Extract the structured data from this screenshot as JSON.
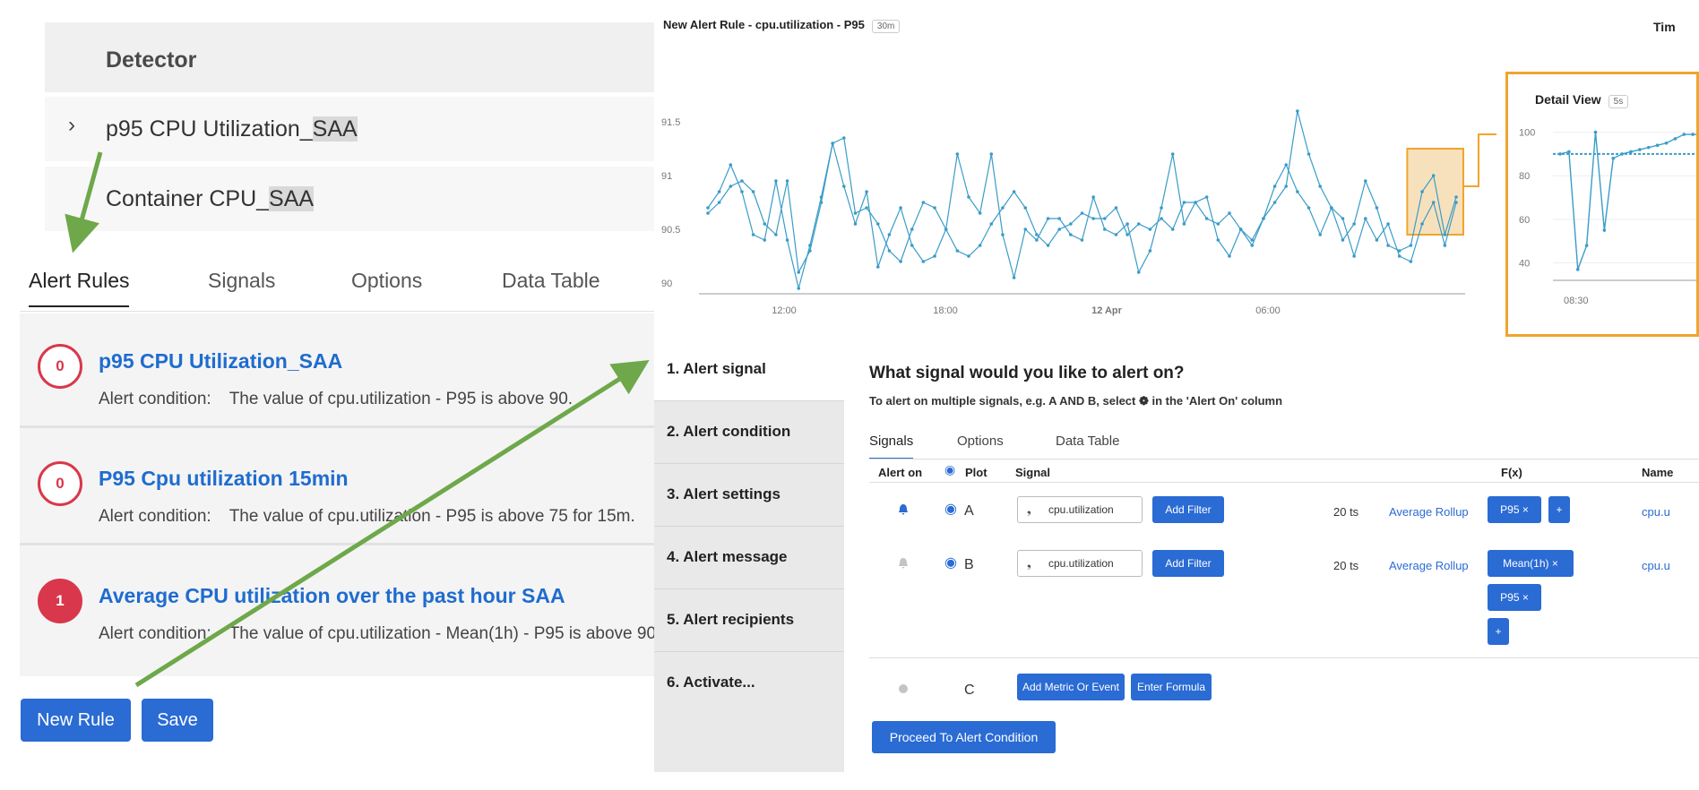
{
  "detector": {
    "header": "Detector",
    "items": [
      {
        "prefix": "p95 CPU Utilization_",
        "highlight": "SAA"
      },
      {
        "prefix": "Container CPU_",
        "highlight": "SAA"
      }
    ]
  },
  "tabs": [
    "Alert Rules",
    "Signals",
    "Options",
    "Data Table"
  ],
  "rules": [
    {
      "count": "0",
      "title": "p95 CPU Utilization_SAA",
      "cond_label": "Alert condition:",
      "cond_text": "The value of cpu.utilization - P95 is above 90."
    },
    {
      "count": "0",
      "title": "P95 Cpu utilization 15min",
      "cond_label": "Alert condition:",
      "cond_text": "The value of cpu.utilization - P95 is above 75 for 15m."
    },
    {
      "count": "1",
      "title": "Average CPU utilization over the past hour SAA",
      "cond_label": "Alert condition:",
      "cond_text": "The value of cpu.utilization - Mean(1h) - P95 is above 90."
    }
  ],
  "buttons": {
    "new_rule": "New Rule",
    "save": "Save"
  },
  "chart": {
    "title": "New Alert Rule - cpu.utilization - P95",
    "range": "30m",
    "time_label": "Tim",
    "detail_title": "Detail View",
    "detail_range": "5s",
    "colors": {
      "line": "#3a9cc8",
      "highlight": "#f0a52c"
    }
  },
  "chart_data": [
    {
      "type": "line",
      "title": "",
      "y_ticks": [
        "90",
        "90.5",
        "91",
        "91.5"
      ],
      "x_ticks": [
        "12:00",
        "18:00",
        "12 Apr",
        "06:00"
      ],
      "ylim": [
        89.9,
        91.8
      ],
      "series": [
        {
          "values": [
            90.7,
            90.85,
            91.1,
            90.85,
            90.45,
            90.4,
            90.95,
            90.4,
            89.95,
            90.35,
            90.8,
            91.3,
            91.35,
            90.65,
            90.7,
            90.55,
            90.3,
            90.2,
            90.5,
            90.75,
            90.7,
            90.5,
            90.3,
            90.25,
            90.35,
            90.55,
            90.7,
            90.85,
            90.7,
            90.45,
            90.35,
            90.5,
            90.55,
            90.65,
            90.6,
            90.6,
            90.7,
            90.45,
            90.55,
            90.5,
            90.6,
            90.5,
            90.75,
            90.75,
            90.6,
            90.55,
            90.65,
            90.5,
            90.4,
            90.6,
            90.75,
            90.9,
            91.6,
            91.2,
            90.9,
            90.7,
            90.4,
            90.55,
            90.95,
            90.7,
            90.35,
            90.3,
            90.35,
            90.85,
            91.0,
            90.45,
            90.8
          ]
        },
        {
          "values": [
            90.65,
            90.75,
            90.9,
            90.95,
            90.85,
            90.55,
            90.45,
            90.95,
            90.1,
            90.3,
            90.75,
            91.3,
            90.9,
            90.55,
            90.85,
            90.15,
            90.45,
            90.7,
            90.35,
            90.2,
            90.25,
            90.5,
            91.2,
            90.8,
            90.65,
            91.2,
            90.45,
            90.05,
            90.5,
            90.4,
            90.6,
            90.6,
            90.45,
            90.4,
            90.8,
            90.5,
            90.45,
            90.55,
            90.1,
            90.3,
            90.7,
            91.2,
            90.55,
            90.75,
            90.8,
            90.4,
            90.25,
            90.5,
            90.35,
            90.6,
            90.9,
            91.1,
            90.85,
            90.7,
            90.45,
            90.7,
            90.6,
            90.25,
            90.6,
            90.4,
            90.55,
            90.25,
            90.2,
            90.55,
            90.75,
            90.35,
            90.75
          ]
        }
      ]
    },
    {
      "type": "line",
      "title": "Detail View",
      "y_ticks": [
        "40",
        "60",
        "80",
        "100"
      ],
      "x_ticks": [
        "08:30"
      ],
      "ylim": [
        32,
        106
      ],
      "threshold": 90,
      "series": [
        {
          "values": [
            90,
            91,
            37,
            48,
            100,
            55,
            88,
            90,
            91,
            92,
            93,
            94,
            95,
            97,
            99,
            99,
            99
          ]
        }
      ]
    }
  ],
  "wizard": {
    "steps": [
      "1.  Alert signal",
      "2.  Alert condition",
      "3.  Alert settings",
      "4.  Alert message",
      "5.  Alert recipients",
      "6.  Activate..."
    ],
    "heading": "What signal would you like to alert on?",
    "sub": "To alert on multiple signals, e.g. A AND B, select ❁ in the 'Alert On' column",
    "tabs": [
      "Signals",
      "Options",
      "Data Table"
    ],
    "columns": {
      "alert_on": "Alert on",
      "plot": "Plot",
      "signal": "Signal",
      "fx": "F(x)",
      "name": "Name"
    },
    "rows": [
      {
        "letter": "A",
        "metric": "cpu.utilization",
        "add_filter": "Add Filter",
        "ts": "20 ts",
        "rollup": "Average Rollup",
        "fx": [
          "P95 ×",
          "+"
        ],
        "name": "cpu.u"
      },
      {
        "letter": "B",
        "metric": "cpu.utilization",
        "add_filter": "Add Filter",
        "ts": "20 ts",
        "rollup": "Average Rollup",
        "fx": [
          "Mean(1h) ×",
          "P95 ×",
          "+"
        ],
        "name": "cpu.u"
      },
      {
        "letter": "C",
        "add_metric": "Add Metric Or Event",
        "enter_formula": "Enter Formula"
      }
    ],
    "proceed": "Proceed To Alert Condition"
  }
}
